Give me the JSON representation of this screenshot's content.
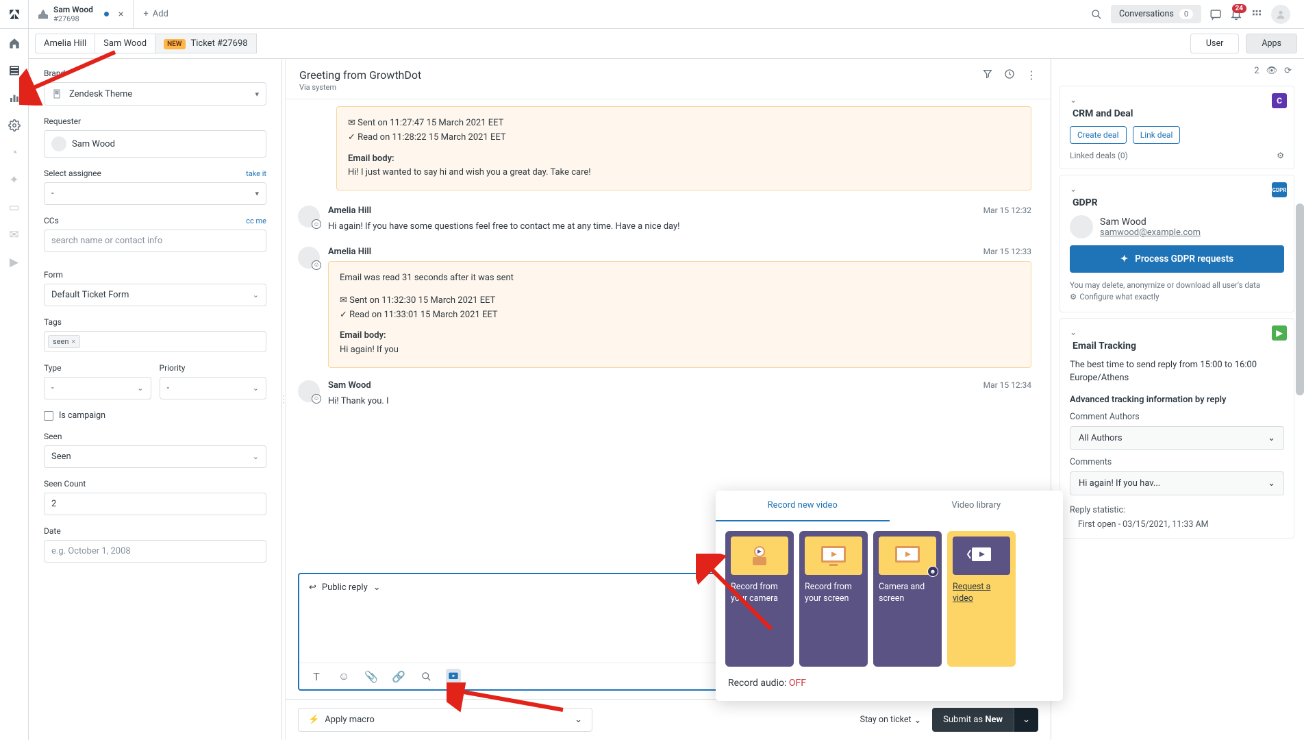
{
  "topbar": {
    "tab_name": "Sam Wood",
    "tab_sub": "#27698",
    "add_label": "Add",
    "conversations_label": "Conversations",
    "conversations_count": "0",
    "bell_count": "24"
  },
  "crumbs": {
    "c1": "Amelia Hill",
    "c2": "Sam Wood",
    "new_badge": "NEW",
    "c3": "Ticket #27698",
    "user_btn": "User",
    "apps_btn": "Apps"
  },
  "sidebar": {
    "brand_label": "Brand",
    "brand_value": "Zendesk Theme",
    "requester_label": "Requester",
    "requester_value": "Sam Wood",
    "assignee_label": "Select assignee",
    "assignee_link": "take it",
    "assignee_value": "-",
    "ccs_label": "CCs",
    "ccs_link": "cc me",
    "ccs_placeholder": "search name or contact info",
    "form_label": "Form",
    "form_value": "Default Ticket Form",
    "tags_label": "Tags",
    "tag1": "seen",
    "type_label": "Type",
    "type_value": "-",
    "priority_label": "Priority",
    "priority_value": "-",
    "iscampaign_label": "Is campaign",
    "seen_label": "Seen",
    "seen_value": "Seen",
    "seencount_label": "Seen Count",
    "seencount_value": "2",
    "date_label": "Date",
    "date_placeholder": "e.g. October 1, 2008"
  },
  "convo": {
    "title": "Greeting from GrowthDot",
    "via": "Via system",
    "m1_sent": "✉ Sent on 11:27:47 15 March 2021 EET",
    "m1_read": "✓ Read on 11:28:22 15 March 2021 EET",
    "m1_eb_label": "Email body:",
    "m1_eb_text": "Hi! I just wanted to say hi and wish you a great day. Take care!",
    "m2_name": "Amelia Hill",
    "m2_time": "Mar 15 12:32",
    "m2_text": "Hi again! If you have some questions feel free to contact me at any time. Have a nice day!",
    "m3_name": "Amelia Hill",
    "m3_time": "Mar 15 12:33",
    "m3_line1": "Email was read 31 seconds after it was sent",
    "m3_sent": "✉ Sent on 11:32:30 15 March 2021 EET",
    "m3_read": "✓ Read on 11:33:01 15 March 2021 EET",
    "m3_eb_label": "Email body:",
    "m3_eb_text": "Hi again! If you",
    "m4_name": "Sam Wood",
    "m4_time": "Mar 15 12:34",
    "m4_text": "Hi! Thank you. I"
  },
  "popover": {
    "tab1": "Record new video",
    "tab2": "Video library",
    "card1": "Record from your camera",
    "card2": "Record from your screen",
    "card3": "Camera and screen",
    "card4": "Request a video",
    "audio_label": "Record audio: ",
    "audio_state": "OFF"
  },
  "editor": {
    "mode": "Public reply",
    "macro_label": "Apply macro"
  },
  "footer": {
    "stay": "Stay on ticket",
    "submit_prefix": "Submit as ",
    "submit_status": "New"
  },
  "right": {
    "view_count": "2",
    "crm_title": "CRM and Deal",
    "crm_btn1": "Create deal",
    "crm_btn2": "Link deal",
    "crm_sub": "Linked deals (0)",
    "gdpr_title": "GDPR",
    "gdpr_name": "Sam Wood",
    "gdpr_email": "samwood@example.com",
    "gdpr_btn": "Process GDPR requests",
    "gdpr_hint1": "You may delete, anonymize or download all user's data",
    "gdpr_hint2": "Configure what exactly",
    "et_title": "Email Tracking",
    "et_line": "The best time to send reply from 15:00 to 16:00 Europe/Athens",
    "et_adv": "Advanced tracking information by reply",
    "et_authors_label": "Comment Authors",
    "et_authors_value": "All Authors",
    "et_comments_label": "Comments",
    "et_comments_value": "Hi again! If you hav...",
    "et_stat_label": "Reply statistic:",
    "et_stat1": "First open - 03/15/2021, 11:33 AM"
  }
}
